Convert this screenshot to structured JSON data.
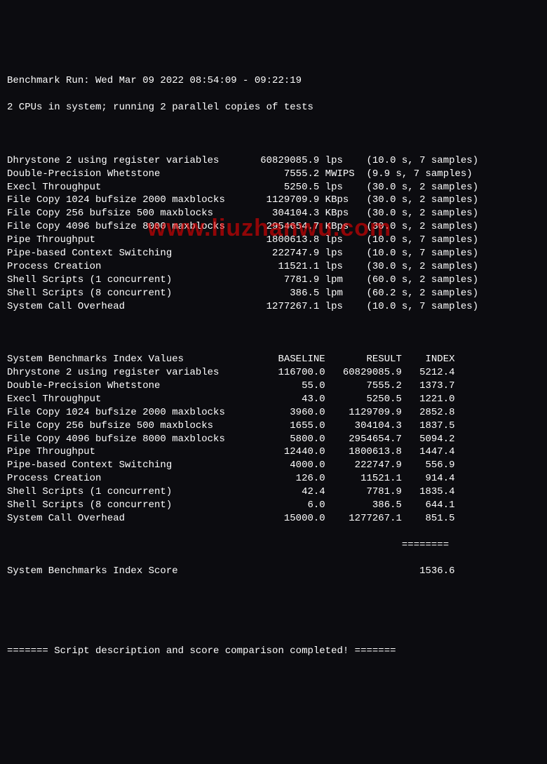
{
  "header": {
    "line1": "Benchmark Run: Wed Mar 09 2022 08:54:09 - 09:22:19",
    "line2": "2 CPUs in system; running 2 parallel copies of tests"
  },
  "results": [
    {
      "name": "Dhrystone 2 using register variables",
      "value": "60829085.9",
      "unit": "lps",
      "meta": "(10.0 s, 7 samples)"
    },
    {
      "name": "Double-Precision Whetstone",
      "value": "7555.2",
      "unit": "MWIPS",
      "meta": "(9.9 s, 7 samples)"
    },
    {
      "name": "Execl Throughput",
      "value": "5250.5",
      "unit": "lps",
      "meta": "(30.0 s, 2 samples)"
    },
    {
      "name": "File Copy 1024 bufsize 2000 maxblocks",
      "value": "1129709.9",
      "unit": "KBps",
      "meta": "(30.0 s, 2 samples)"
    },
    {
      "name": "File Copy 256 bufsize 500 maxblocks",
      "value": "304104.3",
      "unit": "KBps",
      "meta": "(30.0 s, 2 samples)"
    },
    {
      "name": "File Copy 4096 bufsize 8000 maxblocks",
      "value": "2954654.7",
      "unit": "KBps",
      "meta": "(30.0 s, 2 samples)"
    },
    {
      "name": "Pipe Throughput",
      "value": "1800613.8",
      "unit": "lps",
      "meta": "(10.0 s, 7 samples)"
    },
    {
      "name": "Pipe-based Context Switching",
      "value": "222747.9",
      "unit": "lps",
      "meta": "(10.0 s, 7 samples)"
    },
    {
      "name": "Process Creation",
      "value": "11521.1",
      "unit": "lps",
      "meta": "(30.0 s, 2 samples)"
    },
    {
      "name": "Shell Scripts (1 concurrent)",
      "value": "7781.9",
      "unit": "lpm",
      "meta": "(60.0 s, 2 samples)"
    },
    {
      "name": "Shell Scripts (8 concurrent)",
      "value": "386.5",
      "unit": "lpm",
      "meta": "(60.2 s, 2 samples)"
    },
    {
      "name": "System Call Overhead",
      "value": "1277267.1",
      "unit": "lps",
      "meta": "(10.0 s, 7 samples)"
    }
  ],
  "index_header": {
    "title": "System Benchmarks Index Values",
    "col1": "BASELINE",
    "col2": "RESULT",
    "col3": "INDEX"
  },
  "index_rows": [
    {
      "name": "Dhrystone 2 using register variables",
      "baseline": "116700.0",
      "result": "60829085.9",
      "index": "5212.4"
    },
    {
      "name": "Double-Precision Whetstone",
      "baseline": "55.0",
      "result": "7555.2",
      "index": "1373.7"
    },
    {
      "name": "Execl Throughput",
      "baseline": "43.0",
      "result": "5250.5",
      "index": "1221.0"
    },
    {
      "name": "File Copy 1024 bufsize 2000 maxblocks",
      "baseline": "3960.0",
      "result": "1129709.9",
      "index": "2852.8"
    },
    {
      "name": "File Copy 256 bufsize 500 maxblocks",
      "baseline": "1655.0",
      "result": "304104.3",
      "index": "1837.5"
    },
    {
      "name": "File Copy 4096 bufsize 8000 maxblocks",
      "baseline": "5800.0",
      "result": "2954654.7",
      "index": "5094.2"
    },
    {
      "name": "Pipe Throughput",
      "baseline": "12440.0",
      "result": "1800613.8",
      "index": "1447.4"
    },
    {
      "name": "Pipe-based Context Switching",
      "baseline": "4000.0",
      "result": "222747.9",
      "index": "556.9"
    },
    {
      "name": "Process Creation",
      "baseline": "126.0",
      "result": "11521.1",
      "index": "914.4"
    },
    {
      "name": "Shell Scripts (1 concurrent)",
      "baseline": "42.4",
      "result": "7781.9",
      "index": "1835.4"
    },
    {
      "name": "Shell Scripts (8 concurrent)",
      "baseline": "6.0",
      "result": "386.5",
      "index": "644.1"
    },
    {
      "name": "System Call Overhead",
      "baseline": "15000.0",
      "result": "1277267.1",
      "index": "851.5"
    }
  ],
  "score_line": {
    "label": "System Benchmarks Index Score",
    "value": "1536.6"
  },
  "separator_eq": "                                                                   ========",
  "footer": "======= Script description and score comparison completed! =======",
  "watermark": "www.liuzhanwu.com"
}
